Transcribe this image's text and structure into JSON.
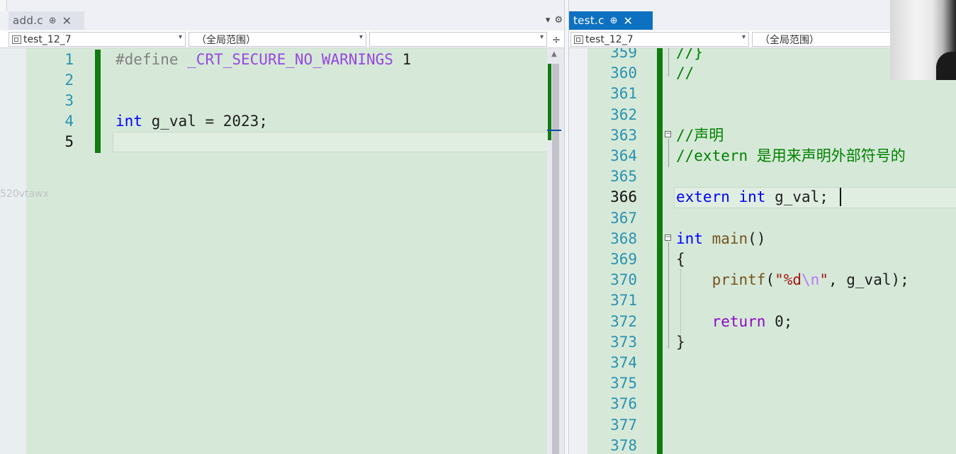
{
  "left_editor": {
    "tab": {
      "filename": "add.c",
      "pin": "⊕",
      "close": "✕"
    },
    "tab_controls": {
      "dropdown": "▾",
      "settings": "⚙"
    },
    "nav": {
      "project": "test_12_7",
      "scope": "（全局范围）",
      "member": "",
      "split_icon": "÷"
    },
    "lines": [
      {
        "number": "1",
        "tokens": [
          {
            "t": "#define ",
            "c": "pp"
          },
          {
            "t": "_CRT_SECURE_NO_WARNINGS",
            "c": "macro"
          },
          {
            "t": " 1",
            "c": "plain"
          }
        ]
      },
      {
        "number": "2",
        "tokens": []
      },
      {
        "number": "3",
        "tokens": []
      },
      {
        "number": "4",
        "tokens": [
          {
            "t": "int",
            "c": "kw"
          },
          {
            "t": " g_val = 2023;",
            "c": "plain"
          }
        ]
      },
      {
        "number": "5",
        "tokens": []
      }
    ],
    "current_line": "5"
  },
  "right_editor": {
    "tab": {
      "filename": "test.c",
      "pin": "⊕",
      "close": "✕"
    },
    "nav": {
      "project": "test_12_7",
      "scope": "（全局范围）"
    },
    "lines": [
      {
        "number": "359",
        "tokens": [
          {
            "t": "//}",
            "c": "cm"
          }
        ]
      },
      {
        "number": "360",
        "tokens": [
          {
            "t": "//",
            "c": "cm"
          }
        ]
      },
      {
        "number": "361",
        "tokens": []
      },
      {
        "number": "362",
        "tokens": []
      },
      {
        "number": "363",
        "tokens": [
          {
            "t": "//声明",
            "c": "cm"
          }
        ]
      },
      {
        "number": "364",
        "tokens": [
          {
            "t": "//extern 是用来声明外部符号的",
            "c": "cm"
          }
        ]
      },
      {
        "number": "365",
        "tokens": []
      },
      {
        "number": "366",
        "tokens": [
          {
            "t": "extern",
            "c": "kw"
          },
          {
            "t": " ",
            "c": "plain"
          },
          {
            "t": "int",
            "c": "kw"
          },
          {
            "t": " g_val;",
            "c": "plain"
          }
        ]
      },
      {
        "number": "367",
        "tokens": []
      },
      {
        "number": "368",
        "tokens": [
          {
            "t": "int",
            "c": "kw"
          },
          {
            "t": " ",
            "c": "plain"
          },
          {
            "t": "main",
            "c": "fn"
          },
          {
            "t": "()",
            "c": "plain"
          }
        ]
      },
      {
        "number": "369",
        "tokens": [
          {
            "t": "{",
            "c": "plain"
          }
        ]
      },
      {
        "number": "370",
        "tokens": [
          {
            "t": "    ",
            "c": "plain"
          },
          {
            "t": "printf",
            "c": "fn"
          },
          {
            "t": "(",
            "c": "plain"
          },
          {
            "t": "\"%d",
            "c": "str"
          },
          {
            "t": "\\n",
            "c": "esc"
          },
          {
            "t": "\"",
            "c": "str"
          },
          {
            "t": ", g_val);",
            "c": "plain"
          }
        ]
      },
      {
        "number": "371",
        "tokens": []
      },
      {
        "number": "372",
        "tokens": [
          {
            "t": "    ",
            "c": "plain"
          },
          {
            "t": "return",
            "c": "ctl"
          },
          {
            "t": " 0;",
            "c": "plain"
          }
        ]
      },
      {
        "number": "373",
        "tokens": [
          {
            "t": "}",
            "c": "plain"
          }
        ]
      },
      {
        "number": "374",
        "tokens": []
      },
      {
        "number": "375",
        "tokens": []
      },
      {
        "number": "376",
        "tokens": []
      },
      {
        "number": "377",
        "tokens": []
      },
      {
        "number": "378",
        "tokens": []
      }
    ],
    "current_line": "366",
    "fold_markers": {
      "collapse": "⊟"
    }
  },
  "watermark": "520vtawx",
  "colors": {
    "editor_bg": "#d6e9d8",
    "change_bar": "#107c10",
    "line_number": "#2b91af",
    "active_tab": "#0e70c0",
    "keyword": "#0000ff",
    "comment": "#008000"
  }
}
